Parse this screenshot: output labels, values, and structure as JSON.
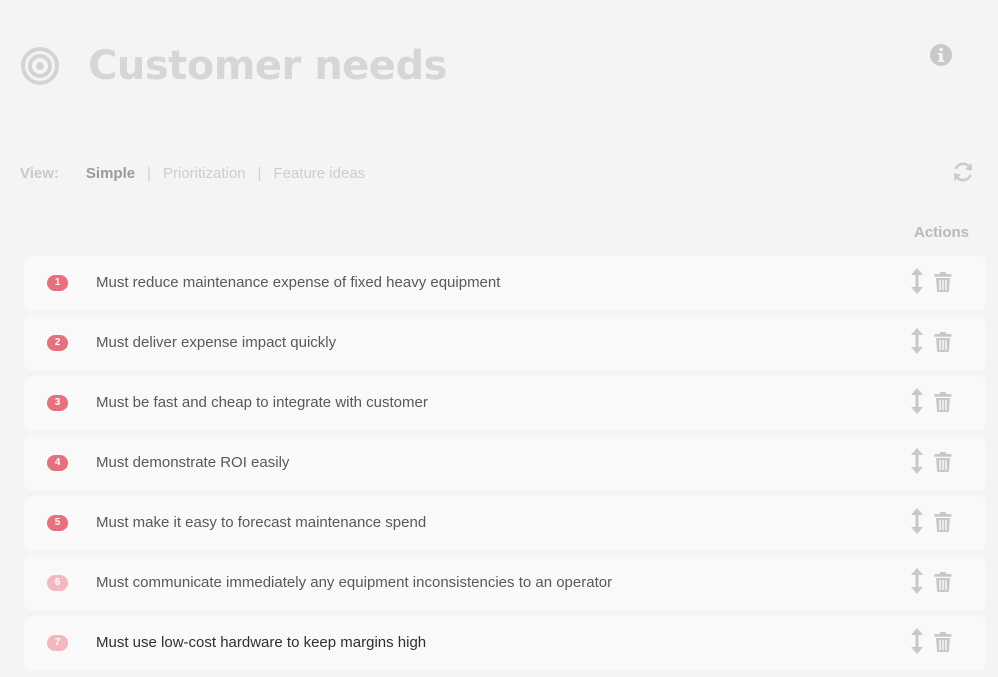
{
  "header": {
    "title": "Customer needs",
    "icon": "target-icon",
    "info_icon": "info-icon"
  },
  "view": {
    "label": "View:",
    "options": [
      "Simple",
      "Prioritization",
      "Feature ideas"
    ],
    "selected": "Simple",
    "refresh_icon": "refresh-icon"
  },
  "table": {
    "actions_label": "Actions"
  },
  "needs": [
    {
      "number": "1",
      "text": "Must reduce maintenance expense of fixed heavy equipment",
      "badge_color": "#e8707d",
      "text_color": "#595959"
    },
    {
      "number": "2",
      "text": "Must deliver expense impact quickly",
      "badge_color": "#e8707d",
      "text_color": "#595959"
    },
    {
      "number": "3",
      "text": "Must be fast and cheap to integrate with customer",
      "badge_color": "#e8707d",
      "text_color": "#595959"
    },
    {
      "number": "4",
      "text": "Must demonstrate ROI easily",
      "badge_color": "#e8707d",
      "text_color": "#595959"
    },
    {
      "number": "5",
      "text": "Must make it easy to forecast maintenance spend",
      "badge_color": "#e8707d",
      "text_color": "#595959"
    },
    {
      "number": "6",
      "text": "Must communicate immediately any equipment inconsistencies to an operator",
      "badge_color": "#f2b7bf",
      "text_color": "#595959"
    },
    {
      "number": "7",
      "text": "Must use low-cost hardware to keep margins high",
      "badge_color": "#f2b7bf",
      "text_color": "#2f2f2f"
    }
  ],
  "row_actions": {
    "move_icon": "move-vertical-icon",
    "delete_icon": "trash-icon"
  },
  "colors": {
    "background": "#f4f4f4",
    "row_background": "#f9f9f9",
    "badge_high": "#e8707d",
    "badge_low": "#f2b7bf",
    "icon_gray": "#c8c8c8"
  }
}
